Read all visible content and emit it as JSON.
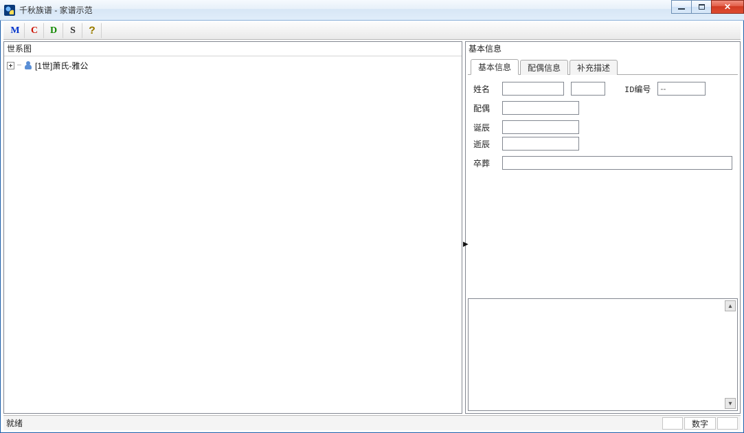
{
  "window": {
    "title": "千秋族谱 - 家谱示范"
  },
  "toolbar": {
    "m": "M",
    "c": "C",
    "d": "D",
    "s": "S",
    "help": "?"
  },
  "left_panel": {
    "title": "世系图",
    "root_label": "[1世]萧氏-雅公"
  },
  "right_panel": {
    "title": "基本信息",
    "tabs": {
      "basic": "基本信息",
      "spouse": "配偶信息",
      "extra": "补充描述"
    },
    "fields": {
      "name_label": "姓名",
      "name_surname": "",
      "name_given": "",
      "id_label": "ID编号",
      "id_value": "--",
      "spouse_label": "配偶",
      "spouse_value": "",
      "birth_label": "诞辰",
      "birth_value": "",
      "death_label": "逝辰",
      "death_value": "",
      "burial_label": "卒葬",
      "burial_value": ""
    }
  },
  "statusbar": {
    "ready": "就绪",
    "num": "数字"
  }
}
